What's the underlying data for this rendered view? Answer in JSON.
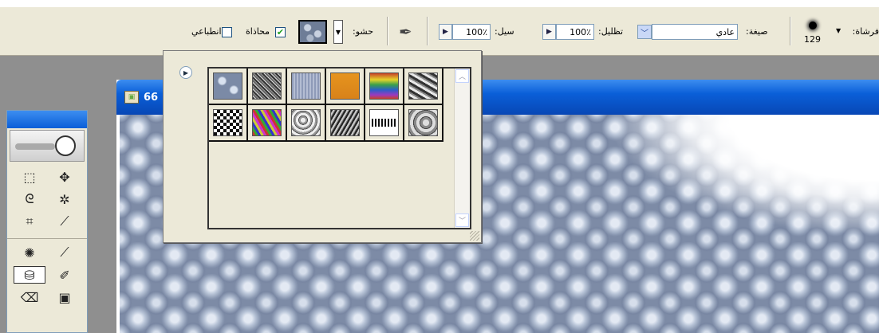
{
  "options_bar": {
    "brush_label": "فرشاة:",
    "brush_size": "129",
    "mode_label": "صيغة:",
    "mode_value": "عادي",
    "opacity_label": "تظليل:",
    "opacity_value": "100٪",
    "flow_label": "سيل:",
    "flow_value": "100٪",
    "pattern_label": "حشو:",
    "aligned_label": "محاذاة",
    "aligned_checked": true,
    "impressionist_label": "انطباعي",
    "impressionist_checked": false
  },
  "document": {
    "title": "66"
  },
  "pattern_picker": {
    "patterns": [
      {
        "icon": "bubbles-pattern-icon"
      },
      {
        "icon": "noise-pattern-icon"
      },
      {
        "icon": "denim-pattern-icon"
      },
      {
        "icon": "orange-pattern-icon"
      },
      {
        "icon": "rainbow-pattern-icon"
      },
      {
        "icon": "marble-pattern-icon"
      },
      {
        "icon": "checker-pattern-icon"
      },
      {
        "icon": "confetti-pattern-icon"
      },
      {
        "icon": "stone-pattern-icon"
      },
      {
        "icon": "gravel-pattern-icon"
      },
      {
        "icon": "herringbone-pattern-icon"
      },
      {
        "icon": "rock-pattern-icon"
      }
    ]
  },
  "colors": {
    "titlebar_blue": "#0a5fd8",
    "panel_bg": "#ece9d8",
    "workspace_gray": "#8f8f8f"
  }
}
